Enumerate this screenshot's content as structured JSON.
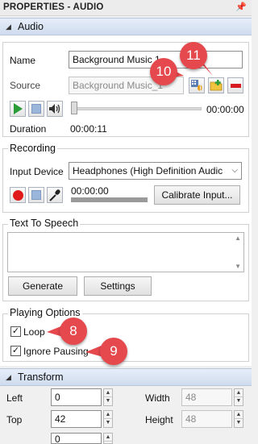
{
  "title_bar": {
    "title": "PROPERTIES - AUDIO",
    "pin_icon": "pin-icon"
  },
  "audio_section": {
    "header": "Audio",
    "name_label": "Name",
    "name_value": "Background Music 1",
    "source_label": "Source",
    "source_value": "Background Music_1",
    "play_time": "00:00:00",
    "duration_label": "Duration",
    "duration_value": "00:00:11"
  },
  "recording": {
    "title": "Recording",
    "input_device_label": "Input Device",
    "input_device_value": "Headphones (High Definition Audic",
    "record_time": "00:00:00",
    "calibrate_label": "Calibrate Input..."
  },
  "tts": {
    "title": "Text To Speech",
    "text_value": "",
    "generate_label": "Generate",
    "settings_label": "Settings"
  },
  "playing_options": {
    "title": "Playing Options",
    "loop_label": "Loop",
    "loop_checked": true,
    "ignore_pausing_label": "Ignore Pausing",
    "ignore_pausing_checked": true
  },
  "callouts": {
    "c10": "10",
    "c11": "11",
    "c8": "8",
    "c9": "9"
  },
  "transform": {
    "header": "Transform",
    "left_label": "Left",
    "left_value": "0",
    "top_label": "Top",
    "top_value": "42",
    "width_label": "Width",
    "width_value": "48",
    "height_label": "Height",
    "height_value": "48",
    "rotation_value": "0"
  },
  "colors": {
    "accent_badge": "#e5484d",
    "play": "#2a9d38",
    "record": "#e01a1a",
    "header_bg": "#d7e3f3"
  }
}
